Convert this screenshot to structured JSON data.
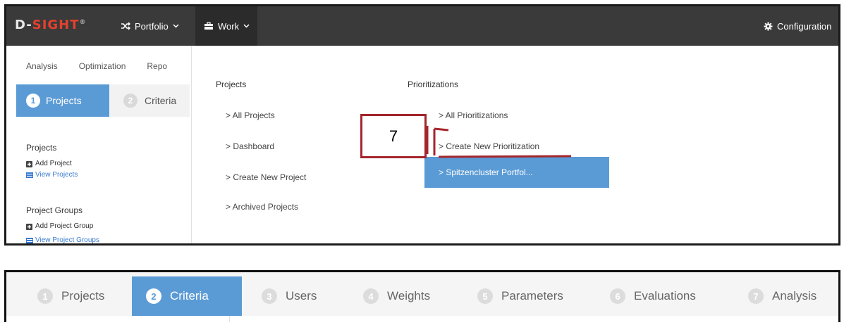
{
  "navbar": {
    "brand_prefix": "D-",
    "brand_accent": "SIGHT",
    "brand_mark": "®",
    "portfolio_label": "Portfolio",
    "work_label": "Work",
    "configuration_label": "Configuration",
    "icons": {
      "portfolio": "shuffle-icon",
      "work": "briefcase-icon",
      "configuration": "gear-icon",
      "caret": "chevron-down-icon"
    }
  },
  "subnav": {
    "items": [
      "Analysis",
      "Optimization",
      "Repo"
    ]
  },
  "side_steps": {
    "active_num": "1",
    "active_label": "Projects",
    "next_num": "2",
    "next_label": "Criteria"
  },
  "sidebar": {
    "projects_title": "Projects",
    "add_project": "Add Project",
    "view_projects": "View Projects",
    "groups_title": "Project Groups",
    "add_group": "Add Project Group",
    "view_groups": "View Project Groups"
  },
  "dropdown": {
    "projects_title": "Projects",
    "projects_links": [
      "> All Projects",
      "> Dashboard",
      "> Create New Project",
      "> Archived Projects"
    ],
    "prioritizations_title": "Prioritizations",
    "prioritizations_links": [
      ">  All Prioritizations",
      ">  Create New Prioritization"
    ],
    "active_item": ">  Spitzencluster Portfol..."
  },
  "annotation": {
    "label": "7"
  },
  "steps": [
    {
      "num": "1",
      "label": "Projects"
    },
    {
      "num": "2",
      "label": "Criteria"
    },
    {
      "num": "3",
      "label": "Users"
    },
    {
      "num": "4",
      "label": "Weights"
    },
    {
      "num": "5",
      "label": "Parameters"
    },
    {
      "num": "6",
      "label": "Evaluations"
    },
    {
      "num": "7",
      "label": "Analysis"
    }
  ],
  "colors": {
    "navbar": "#3a3a3a",
    "accent_blue": "#5b9bd5",
    "brand_red": "#e5402e",
    "annotation_red": "#a4262c"
  }
}
